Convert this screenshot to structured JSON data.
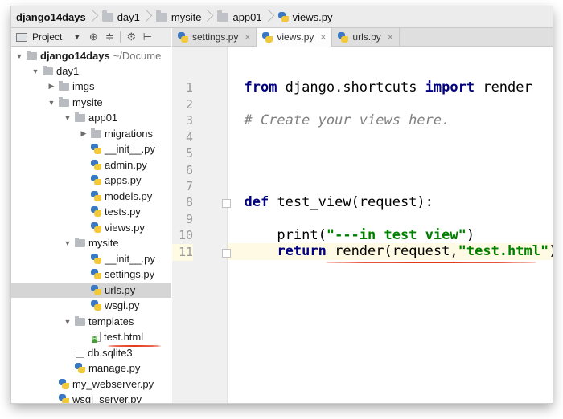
{
  "breadcrumbs": [
    {
      "label": "django14days",
      "icon": "none"
    },
    {
      "label": "day1",
      "icon": "folder-icon"
    },
    {
      "label": "mysite",
      "icon": "folder-icon"
    },
    {
      "label": "app01",
      "icon": "folder-icon"
    },
    {
      "label": "views.py",
      "icon": "python-file-icon"
    }
  ],
  "project_toolbar": {
    "label": "Project",
    "tools": [
      "add-icon",
      "collapse-icon",
      "gear-icon",
      "hide-icon"
    ]
  },
  "tabs": [
    {
      "label": "settings.py",
      "active": false,
      "close": "×"
    },
    {
      "label": "views.py",
      "active": true,
      "close": "×"
    },
    {
      "label": "urls.py",
      "active": false,
      "close": "×"
    }
  ],
  "tree": [
    {
      "label": "django14days",
      "suffix": "~/Docume"
    },
    {
      "label": "day1"
    },
    {
      "label": "imgs"
    },
    {
      "label": "mysite"
    },
    {
      "label": "app01"
    },
    {
      "label": "migrations"
    },
    {
      "label": "__init__.py"
    },
    {
      "label": "admin.py"
    },
    {
      "label": "apps.py"
    },
    {
      "label": "models.py"
    },
    {
      "label": "tests.py"
    },
    {
      "label": "views.py"
    },
    {
      "label": "mysite"
    },
    {
      "label": "__init__.py"
    },
    {
      "label": "settings.py"
    },
    {
      "label": "urls.py",
      "selected": true
    },
    {
      "label": "wsgi.py"
    },
    {
      "label": "templates"
    },
    {
      "label": "test.html"
    },
    {
      "label": "db.sqlite3"
    },
    {
      "label": "manage.py"
    },
    {
      "label": "my_webserver.py"
    },
    {
      "label": "wsgi_server.py"
    }
  ],
  "editor": {
    "line_numbers": [
      "1",
      "2",
      "3",
      "4",
      "5",
      "6",
      "7",
      "8",
      "9",
      "10",
      "11"
    ],
    "current_line": "11",
    "lines": {
      "l1_kw1": "from",
      "l1_t1": " django.shortcuts ",
      "l1_kw2": "import",
      "l1_t2": " render",
      "l3_comment": "# Create your views here.",
      "l8_kw": "def",
      "l8_t": " test_view(request):",
      "l10_t1": "    print(",
      "l10_str": "\"---in test view\"",
      "l10_t2": ")",
      "l11_pad": "    ",
      "l11_kw": "return",
      "l11_t1": " render(request,",
      "l11_str": "\"test.html\"",
      "l11_t2": ")"
    }
  },
  "annotation_color": "#e43a1c"
}
